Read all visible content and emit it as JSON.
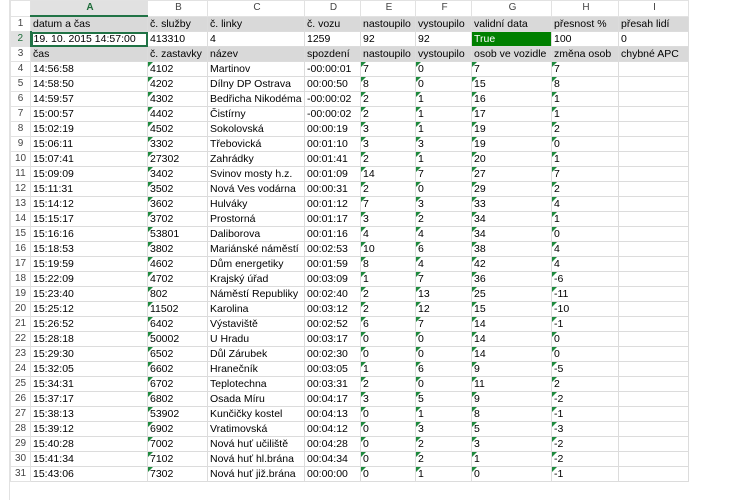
{
  "columns": [
    "A",
    "B",
    "C",
    "D",
    "E",
    "F",
    "G",
    "H",
    "I"
  ],
  "selected_column": "A",
  "selected_row": 2,
  "row1": {
    "num": "1",
    "cells": [
      "datum a čas",
      "č. služby",
      "č. linky",
      "č. vozu",
      "nastoupilo",
      "vystoupilo",
      "validní data",
      "přesnost %",
      "přesah lidí"
    ]
  },
  "row2": {
    "num": "2",
    "cells": [
      "19. 10. 2015 14:57:00",
      "413310",
      "4",
      "1259",
      "92",
      "92",
      "True",
      "100",
      "0"
    ]
  },
  "row3": {
    "num": "3",
    "cells": [
      "čas",
      "č. zastavky",
      "název",
      "spozdení",
      "nastoupilo",
      "vystoupilo",
      "osob ve vozidle",
      "změna osob",
      "chybné APC"
    ]
  },
  "rows": [
    {
      "num": "4",
      "cells": [
        "14:56:58",
        "4102",
        "Martinov",
        "-00:00:01",
        "7",
        "0",
        "7",
        "7",
        ""
      ]
    },
    {
      "num": "5",
      "cells": [
        "14:58:50",
        "4202",
        "Dílny DP Ostrava",
        "00:00:50",
        "8",
        "0",
        "15",
        "8",
        ""
      ]
    },
    {
      "num": "6",
      "cells": [
        "14:59:57",
        "4302",
        "Bedřicha Nikodéma",
        "-00:00:02",
        "2",
        "1",
        "16",
        "1",
        ""
      ]
    },
    {
      "num": "7",
      "cells": [
        "15:00:57",
        "4402",
        "Čistírny",
        "-00:00:02",
        "2",
        "1",
        "17",
        "1",
        ""
      ]
    },
    {
      "num": "8",
      "cells": [
        "15:02:19",
        "4502",
        "Sokolovská",
        "00:00:19",
        "3",
        "1",
        "19",
        "2",
        ""
      ]
    },
    {
      "num": "9",
      "cells": [
        "15:06:11",
        "3302",
        "Třebovická",
        "00:01:10",
        "3",
        "3",
        "19",
        "0",
        ""
      ]
    },
    {
      "num": "10",
      "cells": [
        "15:07:41",
        "27302",
        "Zahrádky",
        "00:01:41",
        "2",
        "1",
        "20",
        "1",
        ""
      ]
    },
    {
      "num": "11",
      "cells": [
        "15:09:09",
        "3402",
        "Svinov mosty h.z.",
        "00:01:09",
        "14",
        "7",
        "27",
        "7",
        ""
      ]
    },
    {
      "num": "12",
      "cells": [
        "15:11:31",
        "3502",
        "Nová Ves vodárna",
        "00:00:31",
        "2",
        "0",
        "29",
        "2",
        ""
      ]
    },
    {
      "num": "13",
      "cells": [
        "15:14:12",
        "3602",
        "Hulváky",
        "00:01:12",
        "7",
        "3",
        "33",
        "4",
        ""
      ]
    },
    {
      "num": "14",
      "cells": [
        "15:15:17",
        "3702",
        "Prostorná",
        "00:01:17",
        "3",
        "2",
        "34",
        "1",
        ""
      ]
    },
    {
      "num": "15",
      "cells": [
        "15:16:16",
        "53801",
        "Daliborova",
        "00:01:16",
        "4",
        "4",
        "34",
        "0",
        ""
      ]
    },
    {
      "num": "16",
      "cells": [
        "15:18:53",
        "3802",
        "Mariánské náměstí",
        "00:02:53",
        "10",
        "6",
        "38",
        "4",
        ""
      ]
    },
    {
      "num": "17",
      "cells": [
        "15:19:59",
        "4602",
        "Dům energetiky",
        "00:01:59",
        "8",
        "4",
        "42",
        "4",
        ""
      ]
    },
    {
      "num": "18",
      "cells": [
        "15:22:09",
        "4702",
        "Krajský úřad",
        "00:03:09",
        "1",
        "7",
        "36",
        "-6",
        ""
      ]
    },
    {
      "num": "19",
      "cells": [
        "15:23:40",
        "802",
        "Náměstí Republiky",
        "00:02:40",
        "2",
        "13",
        "25",
        "-11",
        ""
      ]
    },
    {
      "num": "20",
      "cells": [
        "15:25:12",
        "11502",
        "Karolina",
        "00:03:12",
        "2",
        "12",
        "15",
        "-10",
        ""
      ]
    },
    {
      "num": "21",
      "cells": [
        "15:26:52",
        "6402",
        "Výstaviště",
        "00:02:52",
        "6",
        "7",
        "14",
        "-1",
        ""
      ]
    },
    {
      "num": "22",
      "cells": [
        "15:28:18",
        "50002",
        "U Hradu",
        "00:03:17",
        "0",
        "0",
        "14",
        "0",
        ""
      ]
    },
    {
      "num": "23",
      "cells": [
        "15:29:30",
        "6502",
        "Důl Zárubek",
        "00:02:30",
        "0",
        "0",
        "14",
        "0",
        ""
      ]
    },
    {
      "num": "24",
      "cells": [
        "15:32:05",
        "6602",
        "Hranečník",
        "00:03:05",
        "1",
        "6",
        "9",
        "-5",
        ""
      ]
    },
    {
      "num": "25",
      "cells": [
        "15:34:31",
        "6702",
        "Teplotechna",
        "00:03:31",
        "2",
        "0",
        "11",
        "2",
        ""
      ]
    },
    {
      "num": "26",
      "cells": [
        "15:37:17",
        "6802",
        "Osada Míru",
        "00:04:17",
        "3",
        "5",
        "9",
        "-2",
        ""
      ]
    },
    {
      "num": "27",
      "cells": [
        "15:38:13",
        "53902",
        "Kunčičky kostel",
        "00:04:13",
        "0",
        "1",
        "8",
        "-1",
        ""
      ]
    },
    {
      "num": "28",
      "cells": [
        "15:39:12",
        "6902",
        "Vratimovská",
        "00:04:12",
        "0",
        "3",
        "5",
        "-3",
        ""
      ]
    },
    {
      "num": "29",
      "cells": [
        "15:40:28",
        "7002",
        "Nová huť učiliště",
        "00:04:28",
        "0",
        "2",
        "3",
        "-2",
        ""
      ]
    },
    {
      "num": "30",
      "cells": [
        "15:41:34",
        "7102",
        "Nová huť hl.brána",
        "00:04:34",
        "0",
        "2",
        "1",
        "-2",
        ""
      ]
    },
    {
      "num": "31",
      "cells": [
        "15:43:06",
        "7302",
        "Nová huť již.brána",
        "00:00:00",
        "0",
        "1",
        "0",
        "-1",
        ""
      ]
    }
  ],
  "colors": {
    "header_fill": "#d9d9d9",
    "true_fill": "#008000",
    "selection": "#217346"
  }
}
